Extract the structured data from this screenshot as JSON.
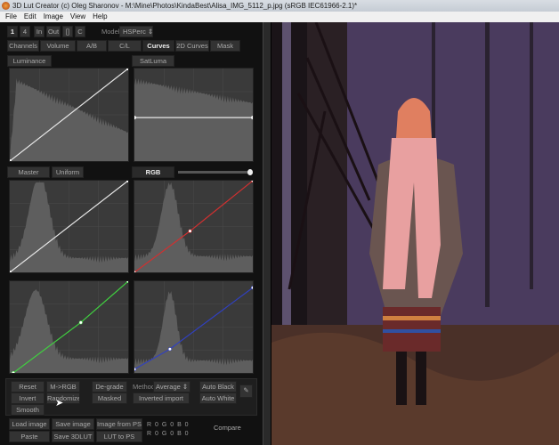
{
  "window": {
    "title": "3D Lut Creator (c) Oleg Sharonov - M:\\Mine\\Photos\\KindaBest\\Alisa_IMG_5112_p.jpg (sRGB IEC61966-2.1)*"
  },
  "menu": [
    "File",
    "Edit",
    "Image",
    "View",
    "Help"
  ],
  "toolbar": {
    "buttons": [
      "1",
      "4",
      "In",
      "Out",
      "[]",
      "C"
    ],
    "model_label": "Model",
    "model_value": "HSPerc"
  },
  "tabs": [
    {
      "label": "Channels"
    },
    {
      "label": "Volume"
    },
    {
      "label": "A/B"
    },
    {
      "label": "C/L"
    },
    {
      "label": "Curves",
      "active": true
    },
    {
      "label": "2D Curves"
    },
    {
      "label": "Mask"
    }
  ],
  "curves": {
    "luminance": "Luminance",
    "satluma": "SatLuma",
    "master": "Master",
    "uniform": "Uniform",
    "rgb": "RGB",
    "rgb_slider": 0.95
  },
  "buttons": {
    "reset": "Reset",
    "m_rgb": "M->RGB",
    "degrade": "De-grade",
    "method_label": "Method",
    "method_value": "Average",
    "auto_black": "Auto Black",
    "invert": "Invert",
    "randomize": "Randomize",
    "masked": "Masked",
    "inverted_import": "Inverted import",
    "auto_white": "Auto White",
    "smooth": "Smooth",
    "load_image": "Load image",
    "save_image": "Save image",
    "image_from_ps": "Image from PS",
    "paste": "Paste",
    "save_3dlut": "Save 3DLUT",
    "lut_to_ps": "LUT to PS",
    "compare": "Compare"
  },
  "readout": {
    "row1": "R 0  G 0  B 0",
    "row2": "R 0  G 0  B 0"
  },
  "colors": {
    "red": "#d03030",
    "green": "#40d040",
    "blue": "#3040c0",
    "white": "#e8e8e8"
  }
}
